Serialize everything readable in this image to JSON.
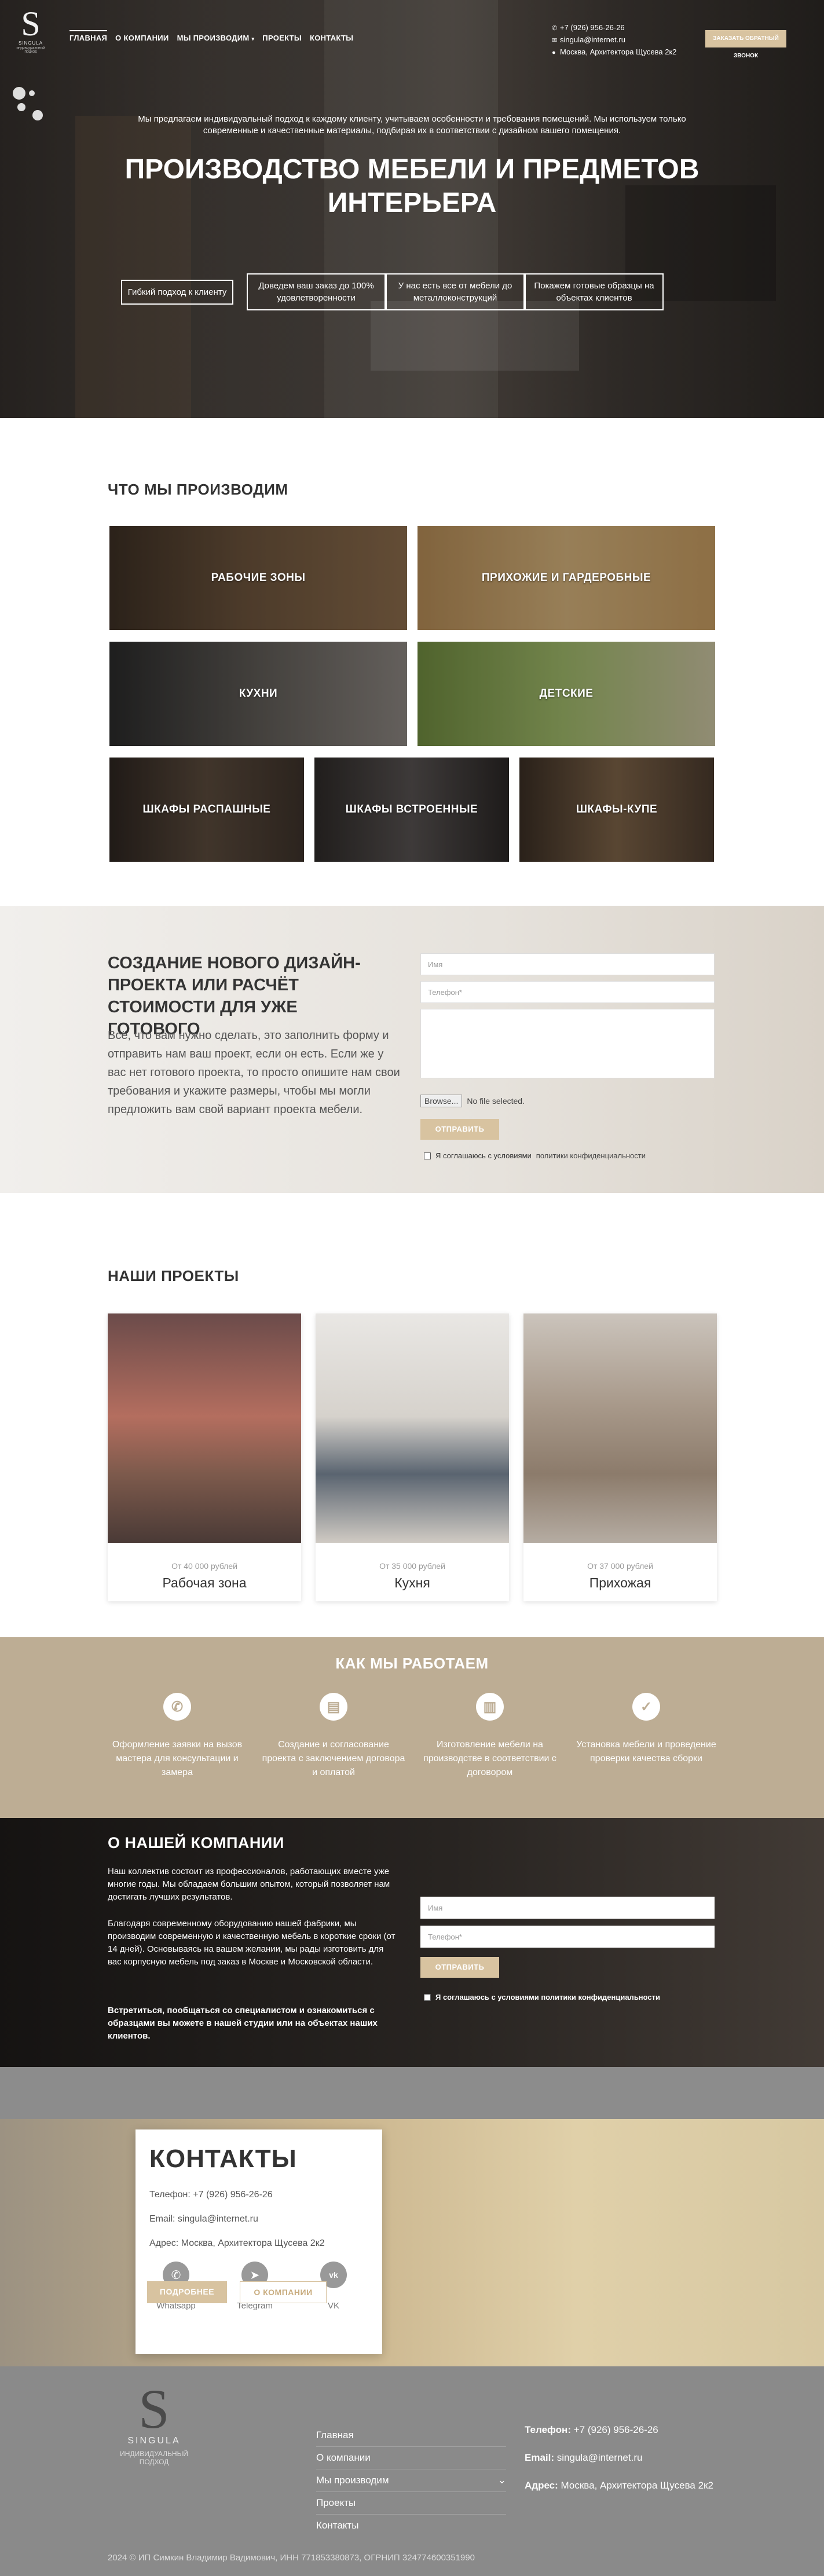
{
  "header": {
    "brand": "SINGULA",
    "brand_sub": "ИНДИВИДУАЛЬНЫЙ ПОДХОД",
    "nav": [
      "ГЛАВНАЯ",
      "О КОМПАНИИ",
      "МЫ ПРОИЗВОДИМ",
      "ПРОЕКТЫ",
      "КОНТАКТЫ"
    ],
    "phone": "+7 (926) 956-26-26",
    "email": "singula@internet.ru",
    "address": "Москва, Архитектора Щусева 2к2",
    "call_button": "ЗАКАЗАТЬ ОБРАТНЫЙ ЗВОНОК"
  },
  "hero": {
    "lead": "Мы предлагаем индивидуальный подход к каждому клиенту, учитываем особенности и требования помещений. Мы используем только современные и качественные материалы, подбирая их в соответствии с дизайном вашего помещения.",
    "title": "ПРОИЗВОДСТВО МЕБЕЛИ И ПРЕДМЕТОВ ИНТЕРЬЕРА",
    "features": [
      "Гибкий подход к клиенту",
      "Доведем ваш заказ до 100% удовлетворенности",
      "У нас есть все от мебели до металлоконструкций",
      "Покажем готовые образцы на объектах клиентов"
    ]
  },
  "produce": {
    "title": "ЧТО МЫ ПРОИЗВОДИМ",
    "items": [
      "РАБОЧИЕ ЗОНЫ",
      "ПРИХОЖИЕ И ГАРДЕРОБНЫЕ",
      "КУХНИ",
      "ДЕТСКИЕ",
      "ШКАФЫ РАСПАШНЫЕ",
      "ШКАФЫ ВСТРОЕННЫЕ",
      "ШКАФЫ-КУПЕ"
    ]
  },
  "form1": {
    "title": "СОЗДАНИЕ НОВОГО ДИЗАЙН-ПРОЕКТА ИЛИ РАСЧЁТ СТОИМОСТИ ДЛЯ УЖЕ ГОТОВОГО",
    "text": "Всё, что вам нужно сделать, это заполнить форму и отправить нам ваш проект, если он есть. Если же у вас нет готового проекта, то просто опишите нам свои требования и укажите размеры, чтобы мы могли предложить вам свой вариант проекта мебели.",
    "name_placeholder": "Имя",
    "phone_placeholder": "Телефон*",
    "browse": "Browse...",
    "no_file": "No file selected.",
    "submit": "ОТПРАВИТЬ",
    "agree_text": "Я соглашаюсь с условиями",
    "agree_link": "политики конфиденциальности"
  },
  "projects": {
    "title": "НАШИ ПРОЕКТЫ",
    "items": [
      {
        "price": "От 40 000 рублей",
        "name": "Рабочая зона"
      },
      {
        "price": "От 35 000 рублей",
        "name": "Кухня"
      },
      {
        "price": "От 37 000 рублей",
        "name": "Прихожая"
      }
    ]
  },
  "how": {
    "title": "КАК МЫ РАБОТАЕМ",
    "steps": [
      "Оформление заявки на вызов мастера для консультации и замера",
      "Создание и согласование проекта с заключением договора и оплатой",
      "Изготовление мебели на производстве в соответствии с договором",
      "Установка мебели и проведение проверки качества сборки"
    ]
  },
  "about": {
    "title": "О НАШЕЙ КОМПАНИИ",
    "p1": "Наш коллектив состоит из профессионалов, работающих вместе уже многие годы. Мы обладаем большим опытом, который позволяет нам достигать лучших результатов.",
    "p2": "Благодаря современному оборудованию нашей фабрики, мы производим современную и качественную мебель в короткие сроки (от 14 дней). Основываясь на вашем желании, мы рады изготовить для вас корпусную мебель под заказ в Москве и Московской области.",
    "p3": "Встретиться, пообщаться со специалистом и ознакомиться с образцами вы можете в нашей студии или на объектах наших клиентов.",
    "name_placeholder": "Имя",
    "phone_placeholder": "Телефон*",
    "submit": "ОТПРАВИТЬ",
    "agree": "Я соглашаюсь с условиями политики конфиденциальности"
  },
  "contacts": {
    "title": "КОНТАКТЫ",
    "phone": "Телефон: +7 (926) 956-26-26",
    "email": "Email: singula@internet.ru",
    "address": "Адрес: Москва, Архитектора Щусева 2к2",
    "socials": [
      "Whatsapp",
      "Telegram",
      "VK"
    ],
    "btn_more": "ПОДРОБНЕЕ",
    "btn_about": "О КОМПАНИИ"
  },
  "footer": {
    "links": [
      "Главная",
      "О компании",
      "Мы производим",
      "Проекты",
      "Контакты"
    ],
    "phone_label": "Телефон:",
    "phone": "+7 (926) 956-26-26",
    "email_label": "Email:",
    "email": "singula@internet.ru",
    "address_label": "Адрес:",
    "address": "Москва, Архитектора Щусева 2к2",
    "copyright": "2024 © ИП Симкин Владимир Вадимович, ИНН 771853380873, ОГРНИП 324774600351990"
  },
  "colors": {
    "accent": "#d8c3a0",
    "how_bg": "#bdad94",
    "footer_bg": "#8a8a8a"
  }
}
